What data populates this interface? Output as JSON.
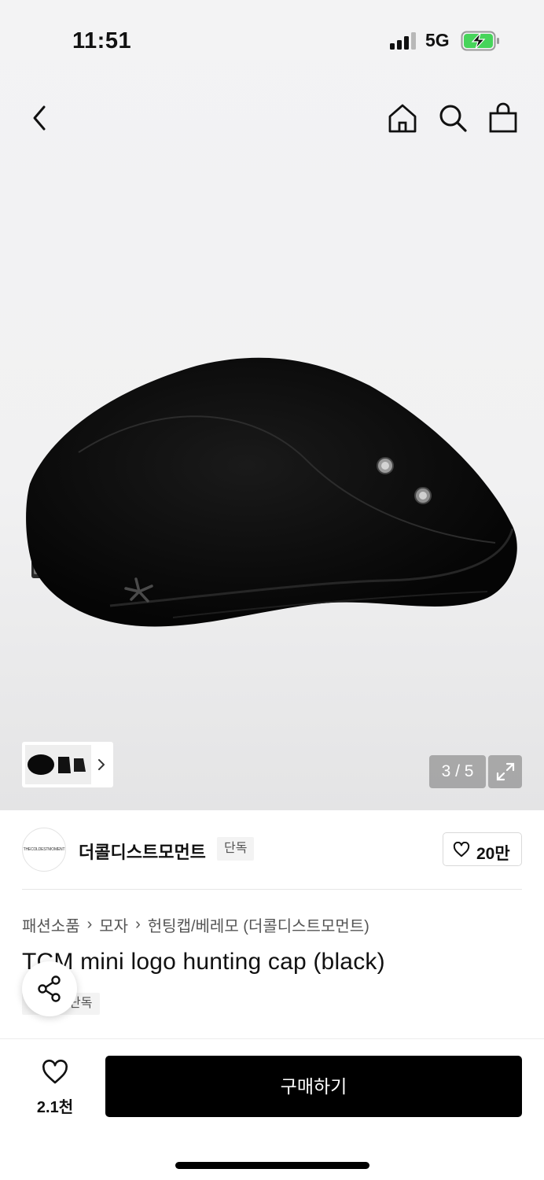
{
  "status_bar": {
    "time": "11:51",
    "network": "5G"
  },
  "gallery": {
    "counter": "3 / 5"
  },
  "brand": {
    "name": "더콜디스트모먼트",
    "badge": "단독",
    "like_count": "20만",
    "logo_text": "THECOLDESTMOMENT"
  },
  "breadcrumb": [
    "패션소품",
    "모자",
    "헌팅캡/베레모 (더콜디스트모먼트)"
  ],
  "product": {
    "title": "TCM mini logo hunting cap (black)",
    "badge": "단독"
  },
  "bottom_bar": {
    "wish_count": "2.1천",
    "buy_label": "구매하기"
  }
}
